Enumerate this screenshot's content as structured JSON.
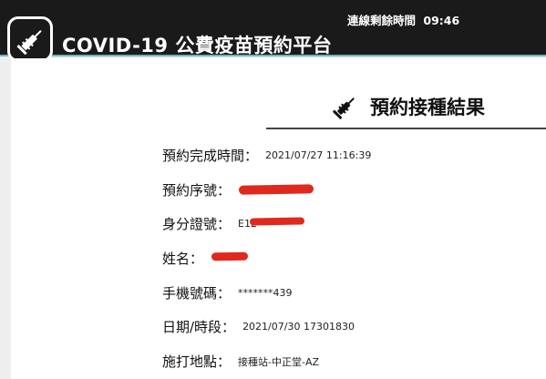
{
  "header": {
    "app_title": "COVID-19 公費疫苗預約平台",
    "logo_icon": "syringe-icon",
    "timer_label": "連線剩餘時間",
    "timer_value": "09:46"
  },
  "result": {
    "title": "預約接種結果",
    "title_icon": "syringe-icon",
    "rows": [
      {
        "label": "預約完成時間：",
        "value": "2021/07/27 11:16:39"
      },
      {
        "label": "預約序號：",
        "value": ""
      },
      {
        "label": "身分證號：",
        "value": "E12"
      },
      {
        "label": "姓名：",
        "value": ""
      },
      {
        "label": "手機號碼：",
        "value": "*******439"
      },
      {
        "label": "日期/時段：",
        "value": "2021/07/30 17301830"
      },
      {
        "label": "施打地點：",
        "value": "接種站-中正堂-AZ"
      }
    ]
  },
  "colors": {
    "header_bg": "#1a1a1a",
    "header_border": "#6fb3bd",
    "redaction": "#e0281e"
  }
}
